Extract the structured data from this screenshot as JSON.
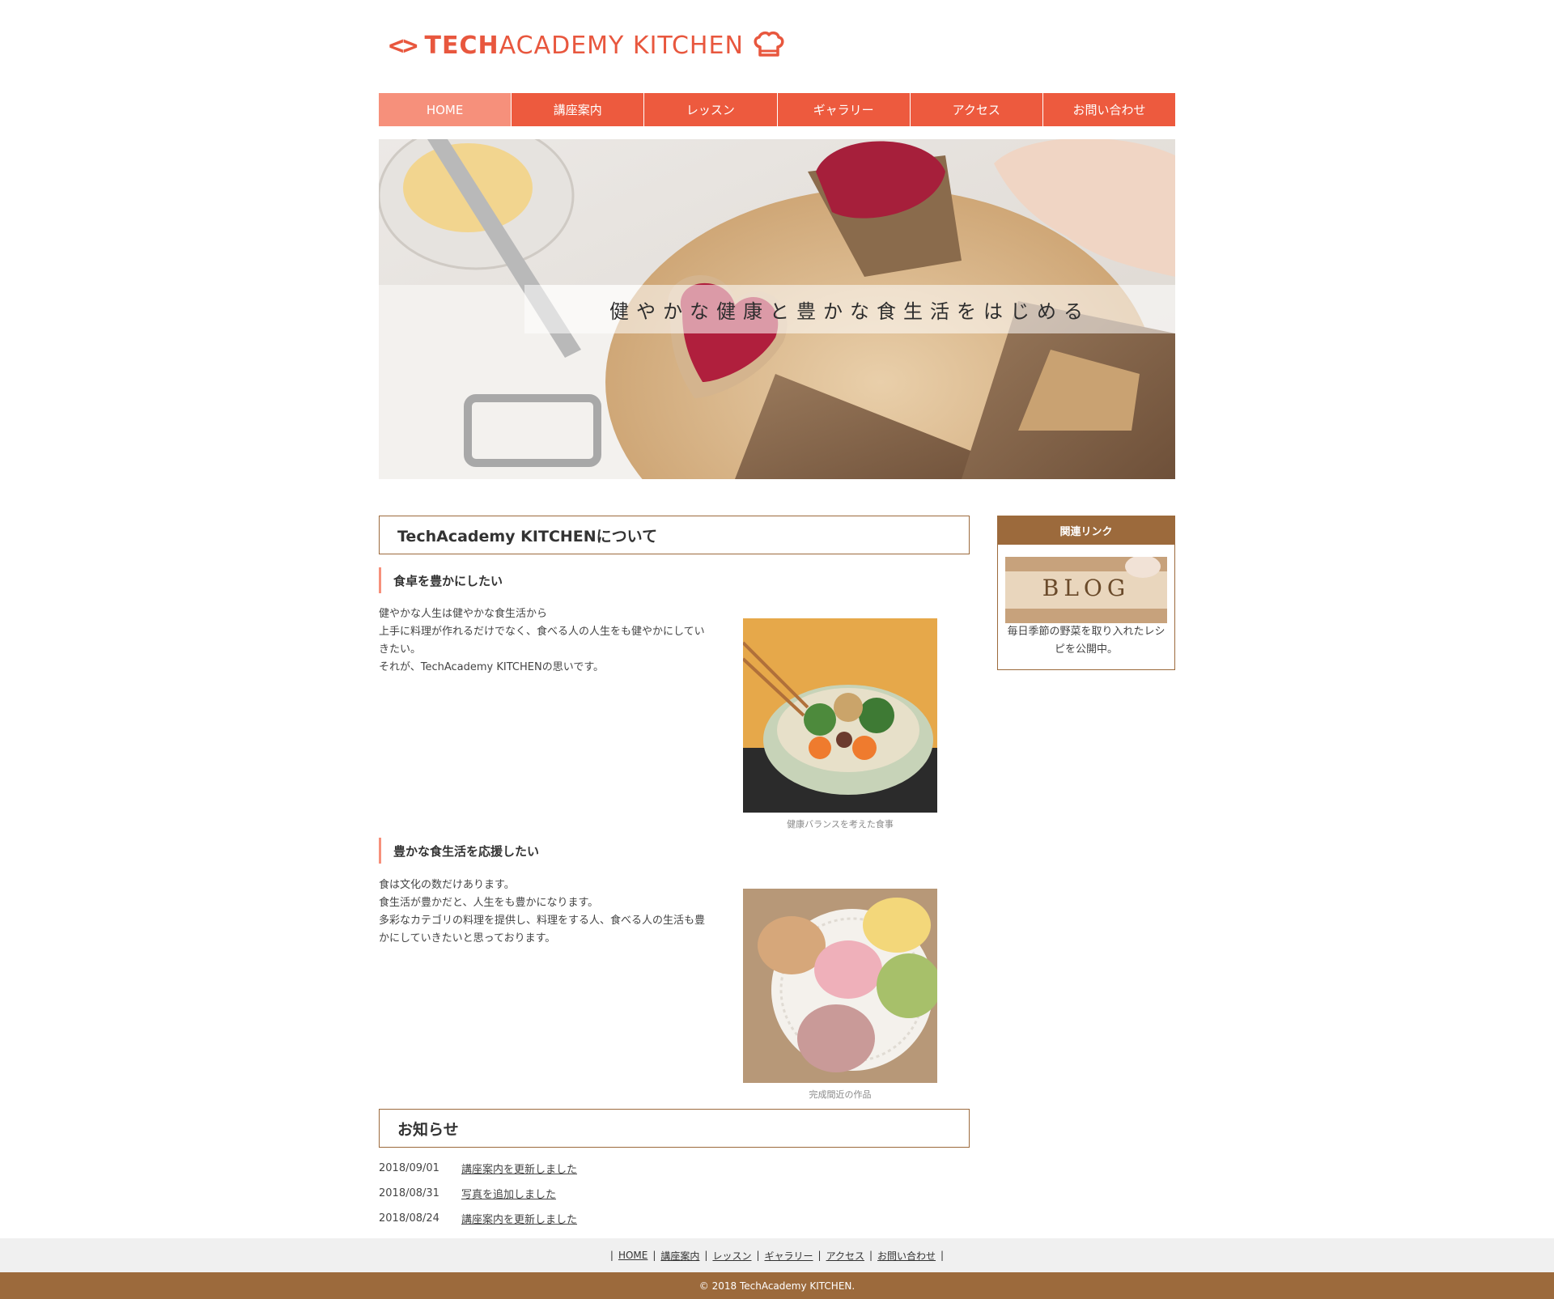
{
  "logo": {
    "mark": "<>",
    "tech": "TECH",
    "academy": "ACADEMY KITCHEN",
    "brand_color": "#e8573e"
  },
  "nav": {
    "items": [
      "HOME",
      "講座案内",
      "レッスン",
      "ギャラリー",
      "アクセス",
      "お問い合わせ"
    ],
    "active": "HOME",
    "color": "#ed5a3e",
    "active_color": "#f6907b"
  },
  "hero": {
    "copy": "健やかな健康と豊かな食生活をはじめる"
  },
  "about": {
    "heading": "TechAcademy KITCHENについて",
    "sections": [
      {
        "title": "食卓を豊かにしたい",
        "lines": [
          "健やかな人生は健やかな食生活から",
          "上手に料理が作れるだけでなく、食べる人の人生をも健やかにしてい",
          "きたい。",
          "それが、TechAcademy KITCHENの思いです。"
        ],
        "caption": "健康バランスを考えた食事"
      },
      {
        "title": "豊かな食生活を応援したい",
        "lines": [
          "食は文化の数だけあります。",
          "食生活が豊かだと、人生をも豊かになります。",
          "多彩なカテゴリの料理を提供し、料理をする人、食べる人の生活も豊",
          "かにしていきたいと思っております。"
        ],
        "caption": "完成間近の作品"
      }
    ]
  },
  "news": {
    "heading": "お知らせ",
    "items": [
      {
        "date": "2018/09/01",
        "text": "講座案内を更新しました"
      },
      {
        "date": "2018/08/31",
        "text": "写真を追加しました"
      },
      {
        "date": "2018/08/24",
        "text": "講座案内を更新しました"
      }
    ]
  },
  "sidebar": {
    "heading": "関連リンク",
    "banner_word": "BLOG",
    "text_line1": "毎日季節の野菜を取り入れたレシ",
    "text_line2": "ピを公開中。",
    "color": "#9c6a3c"
  },
  "footer": {
    "links": [
      "HOME",
      "講座案内",
      "レッスン",
      "ギャラリー",
      "アクセス",
      "お問い合わせ"
    ],
    "copyright": "© 2018 TechAcademy KITCHEN."
  }
}
